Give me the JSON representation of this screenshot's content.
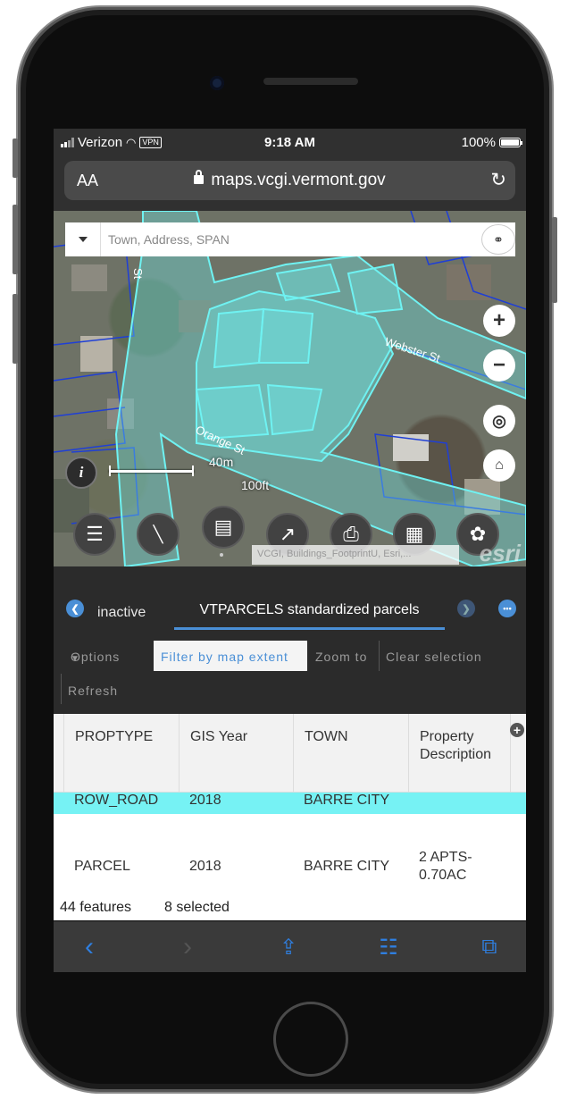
{
  "status_bar": {
    "carrier": "Verizon",
    "vpn": "VPN",
    "time": "9:18 AM",
    "battery": "100%"
  },
  "browser": {
    "text_size": "AA",
    "url": "maps.vcgi.vermont.gov"
  },
  "search": {
    "placeholder": "Town, Address, SPAN"
  },
  "map": {
    "street_labels": [
      "Webster St",
      "Orange St",
      "St"
    ],
    "scale_m": "40m",
    "scale_ft": "100ft",
    "attribution": "VCGI, Buildings_FootprintU, Esri,...",
    "watermark": "esri",
    "parcel_color": "#6ff2f2",
    "boundary_color": "#1f3fd6"
  },
  "panel": {
    "tab_inactive": "inactive",
    "tab_active": "VTPARCELS standardized parcels",
    "options": {
      "options_label": "Options",
      "filter_label": "Filter by map extent",
      "zoom_label": "Zoom to",
      "clear_label": "Clear selection",
      "refresh_label": "Refresh"
    },
    "columns": [
      "PROPTYPE",
      "GIS Year",
      "TOWN",
      "Property Description"
    ],
    "rows": [
      {
        "proptype": "ROW_ROAD",
        "year": "2018",
        "town": "BARRE CITY",
        "desc": ""
      },
      {
        "proptype": "PARCEL",
        "year": "2018",
        "town": "BARRE CITY",
        "desc": "2 APTS-0.70AC"
      }
    ],
    "footer": {
      "features": "44 features",
      "selected": "8 selected"
    },
    "selection_color": "#76f2f4",
    "accent_color": "#4a8fd6"
  },
  "icons": {
    "map_buttons": [
      "zoom-in-icon",
      "zoom-out-icon",
      "locate-icon",
      "home-icon"
    ],
    "tools": [
      "layers-icon",
      "measure-icon",
      "table-icon",
      "select-icon",
      "print-icon",
      "basemap-gallery-icon",
      "theme-icon"
    ],
    "browser": [
      "back-icon",
      "forward-icon",
      "share-icon",
      "bookmarks-icon",
      "tabs-icon"
    ]
  }
}
